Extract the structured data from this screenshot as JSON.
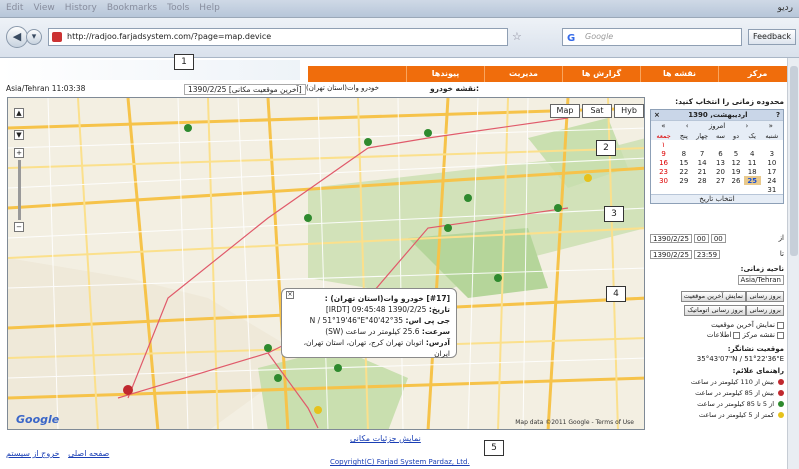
{
  "browser": {
    "window_title": "رديو",
    "menu": [
      "Edit",
      "View",
      "History",
      "Bookmarks",
      "Tools",
      "Help"
    ],
    "url": "http://radjoo.farjadsystem.com/?page=map.device",
    "search_placeholder": "Google",
    "search_engine_glyph": "G",
    "feedback_label": "Feedback"
  },
  "site_nav": {
    "items": [
      "مرکز",
      "نقشه ها",
      "گزارش ها",
      "مدیریت",
      "پیوندها"
    ],
    "accent": "#f06d0c"
  },
  "map_header": {
    "timezone_clock": "Asia/Tehran 11:03:38",
    "last_position_label": "1390/2/25 [آخرین موقعیت مکانی]",
    "vehicle_select": "خودرو وات(استان تهران)",
    "map_label": "نقشه خودرو:"
  },
  "map": {
    "types": [
      "Map",
      "Sat",
      "Hyb"
    ],
    "popup": {
      "title": "[#17] خودرو وات(استان تهران) :",
      "date_label": "تاریخ:",
      "date_value": "1390/2/25 09:45:48 [IRDT]",
      "gps_label": "جی پی اس:",
      "gps_value": "35°42'40\"N / 51°19'46\"E",
      "speed_label": "سرعت:",
      "speed_value": "25.6 کیلومتر در ساعت (SW)",
      "address_label": "آدرس:",
      "address_value": "اتوبان تهران کرج، تهران، استان تهران، ایران"
    },
    "footer": "Map data ©2011 Google - Terms of Use",
    "logo": "Google"
  },
  "sidebar": {
    "heading": "محدوده زمانی را انتخاب کنید:",
    "calendar": {
      "month_title": "اردیبهشت, 1390",
      "nav": [
        "«",
        "‹",
        "امروز",
        "›",
        "»"
      ],
      "help": "?",
      "day_names": [
        "شنبه",
        "یک",
        "دو",
        "سه",
        "چهار",
        "پنج",
        "جمعه"
      ],
      "weeks": [
        [
          "",
          "",
          "",
          "",
          "",
          "",
          "۱"
        ],
        [
          "3",
          "4",
          "5",
          "6",
          "7",
          "8",
          "9"
        ],
        [
          "10",
          "11",
          "12",
          "13",
          "14",
          "15",
          "16"
        ],
        [
          "17",
          "18",
          "19",
          "20",
          "21",
          "22",
          "23"
        ],
        [
          "24",
          "25",
          "26",
          "27",
          "28",
          "29",
          "30"
        ],
        [
          "31",
          "",
          "",
          "",
          "",
          "",
          ""
        ]
      ],
      "today": "25",
      "footer": "انتخاب تاریخ"
    },
    "from_label": "از",
    "from_date": "1390/2/25",
    "from_hour": "00",
    "from_min": "00",
    "to_label": "تا",
    "to_date": "1390/2/25",
    "to_time": "23:59",
    "zone_label": "ناحیه زمانی:",
    "zone_value": "Asia/Tehran",
    "buttons": {
      "refresh": "بروز رسانی",
      "show_last": "نمایش آخرین موقعیت",
      "refresh2": "بروز رسانی",
      "refresh_auto": "بروز رسانی اتوماتیک"
    },
    "checks": {
      "show_last_pos": "نمایش آخرین موقعیت",
      "center_map": "نقشه مرکز",
      "show_info": "اطلاعات"
    },
    "location_label": "موقعیت نشانگر:",
    "location_value": "35°43'07\"N / 51°22'36\"E",
    "legend_label": "راهنمای علائم:",
    "legend": [
      {
        "text": "بیش از 110 کیلومتر در ساعت",
        "color": "#c0282e"
      },
      {
        "text": "بیش از 85 کیلومتر در ساعت",
        "color": "#c0282e"
      },
      {
        "text": "از 5 تا 85 کیلومتر در ساعت",
        "color": "#2e8a2e"
      },
      {
        "text": "کمتر از 5 کیلومتر در ساعت",
        "color": "#e6c21c"
      }
    ]
  },
  "below_map_link": "نمایش جزئیات مکانی",
  "bottom_links": [
    "صفحه اصلی",
    "خروج از سیستم"
  ],
  "copyright": "Copyright(C) Farjad System Pardaz, Ltd.",
  "callouts": [
    "1",
    "2",
    "3",
    "4",
    "5"
  ]
}
